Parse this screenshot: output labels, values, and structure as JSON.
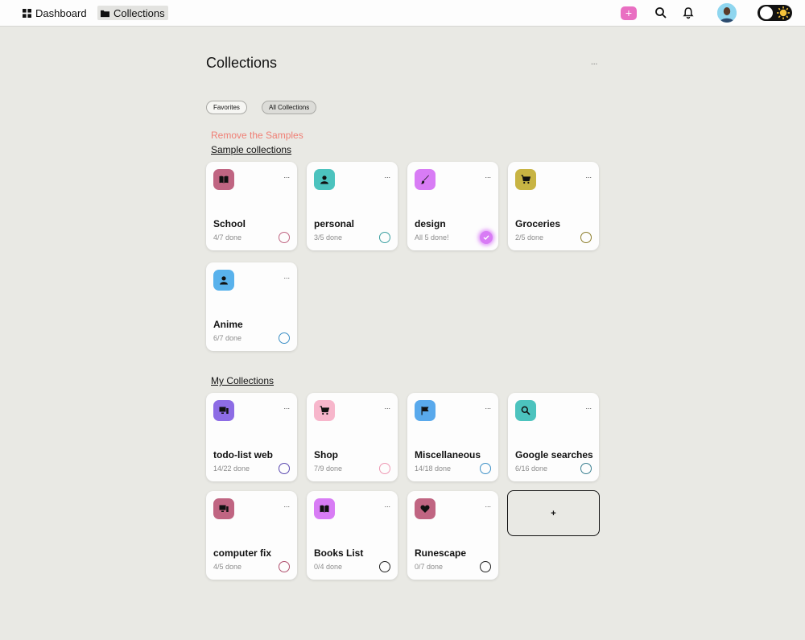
{
  "nav": {
    "dashboard_label": "Dashboard",
    "collections_label": "Collections",
    "add_label": "+",
    "accent": "#e96fc2"
  },
  "page": {
    "title": "Collections",
    "more": "...",
    "filters": [
      "Favorites",
      "All Collections"
    ],
    "remove_samples": "Remove the Samples",
    "samples_title": "Sample collections",
    "mine_title": "My Collections",
    "add_card_label": "+"
  },
  "sample_collections": [
    {
      "name": "School",
      "status": "4/7 done",
      "icon": "book-icon",
      "color": "#c06582",
      "more": "..."
    },
    {
      "name": "personal",
      "status": "3/5 done",
      "icon": "person-icon",
      "color": "#4cc3be",
      "more": "..."
    },
    {
      "name": "design",
      "status": "All 5 done!",
      "icon": "brush-icon",
      "color": "#d87cf5",
      "more": "...",
      "complete": true
    },
    {
      "name": "Groceries",
      "status": "2/5 done",
      "icon": "cart-icon",
      "color": "#c8b443",
      "more": "..."
    },
    {
      "name": "Anime",
      "status": "6/7 done",
      "icon": "person-icon",
      "color": "#59b2ec",
      "more": "..."
    }
  ],
  "my_collections": [
    {
      "name": "todo-list web",
      "status": "14/22 done",
      "icon": "devices-icon",
      "color": "#8d6ce5",
      "more": "..."
    },
    {
      "name": "Shop",
      "status": "7/9 done",
      "icon": "cart-icon",
      "color": "#f7b6cb",
      "more": "..."
    },
    {
      "name": "Miscellaneous",
      "status": "14/18 done",
      "icon": "flag-icon",
      "color": "#59a9ec",
      "more": "..."
    },
    {
      "name": "Google searches",
      "status": "6/16 done",
      "icon": "search-icon",
      "color": "#4cc3be",
      "more": "..."
    },
    {
      "name": "computer fix",
      "status": "4/5 done",
      "icon": "devices-icon",
      "color": "#c06582",
      "more": "..."
    },
    {
      "name": "Books List",
      "status": "0/4 done",
      "icon": "book-icon",
      "color": "#d87cf5",
      "more": "..."
    },
    {
      "name": "Runescape",
      "status": "0/7 done",
      "icon": "heart-icon",
      "color": "#c06582",
      "more": "..."
    }
  ]
}
